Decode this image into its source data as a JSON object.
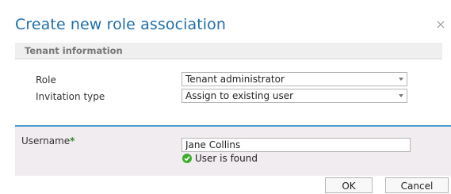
{
  "dialog": {
    "title": "Create new role association",
    "close_icon": "close-icon"
  },
  "tenant_section": {
    "header": "Tenant information",
    "role": {
      "label": "Role",
      "value": "Tenant administrator"
    },
    "invitation_type": {
      "label": "Invitation type",
      "value": "Assign to existing user"
    }
  },
  "user_section": {
    "username_label": "Username",
    "required_mark": "*",
    "username_value": "Jane Collins",
    "status_text": "User is found",
    "status_icon": "check-circle-icon"
  },
  "buttons": {
    "ok": "OK",
    "cancel": "Cancel"
  },
  "colors": {
    "title": "#1f6fa8",
    "accent_border": "#4c9ad2",
    "required": "#2f8a2f",
    "success": "#3fae2a"
  }
}
